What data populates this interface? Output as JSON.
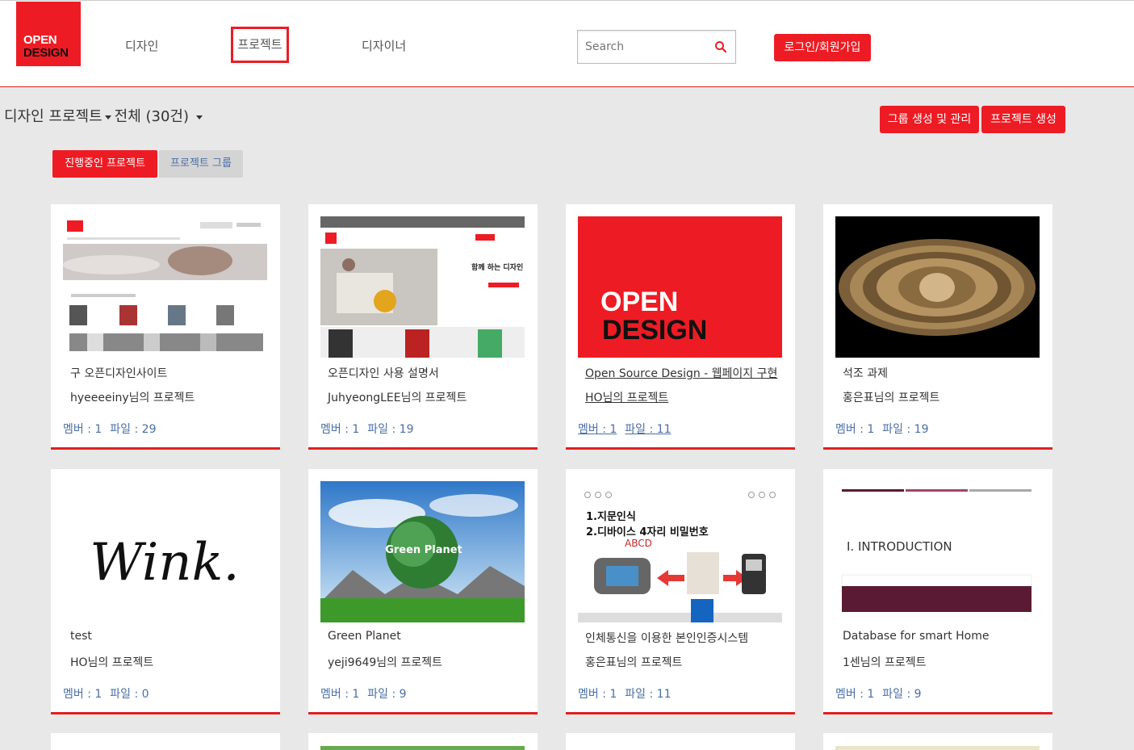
{
  "header": {
    "logo_line1": "OPEN",
    "logo_line2": "DESIGN",
    "nav": [
      "디자인",
      "프로젝트",
      "디자이너"
    ],
    "search_placeholder": "Search",
    "login_label": "로그인/회원가입"
  },
  "subheader": {
    "title_part1": "디자인 프로젝트",
    "title_part2": "전체 (30건)",
    "group_button": "그룹 생성 및 관리",
    "create_button": "프로젝트 생성",
    "tab_active": "진행중인 프로젝트",
    "tab_inactive": "프로젝트 그룹"
  },
  "cards": [
    {
      "title": "구 오픈디자인사이트",
      "owner": "hyeeeeiny님의 프로젝트",
      "members": "멤버 : 1",
      "files": "파일 : 29"
    },
    {
      "title": "오픈디자인 사용 설명서",
      "owner": "JuhyeongLEE님의 프로젝트",
      "members": "멤버 : 1",
      "files": "파일 : 19",
      "thumb_text": "함께 하는 디자인"
    },
    {
      "title": "Open Source Design - 웹페이지 구현",
      "owner": "HO님의 프로젝트",
      "members": "멤버 : 1",
      "files": "파일 : 11",
      "thumb_line1": "OPEN",
      "thumb_line2": "DESIGN"
    },
    {
      "title": "석조 과제",
      "owner": "홍은표님의 프로젝트",
      "members": "멤버 : 1",
      "files": "파일 : 19"
    },
    {
      "title": "test",
      "owner": "HO님의 프로젝트",
      "members": "멤버 : 1",
      "files": "파일 : 0",
      "thumb_text": "Wink."
    },
    {
      "title": "Green Planet",
      "owner": "yeji9649님의 프로젝트",
      "members": "멤버 : 1",
      "files": "파일 : 9",
      "thumb_text": "Green Planet"
    },
    {
      "title": "인체통신을 이용한 본인인증시스템",
      "owner": "홍은표님의 프로젝트",
      "members": "멤버 : 1",
      "files": "파일 : 11",
      "thumb_l1": "1.지문인식",
      "thumb_l2": "2.디바이스 4자리 비밀번호",
      "thumb_l3": "ABCD"
    },
    {
      "title": "Database for smart Home",
      "owner": "1센님의 프로젝트",
      "members": "멤버 : 1",
      "files": "파일 : 9",
      "thumb_text": "I. INTRODUCTION"
    }
  ],
  "colors": {
    "accent": "#ed1c24",
    "link": "#4a6fa5"
  }
}
